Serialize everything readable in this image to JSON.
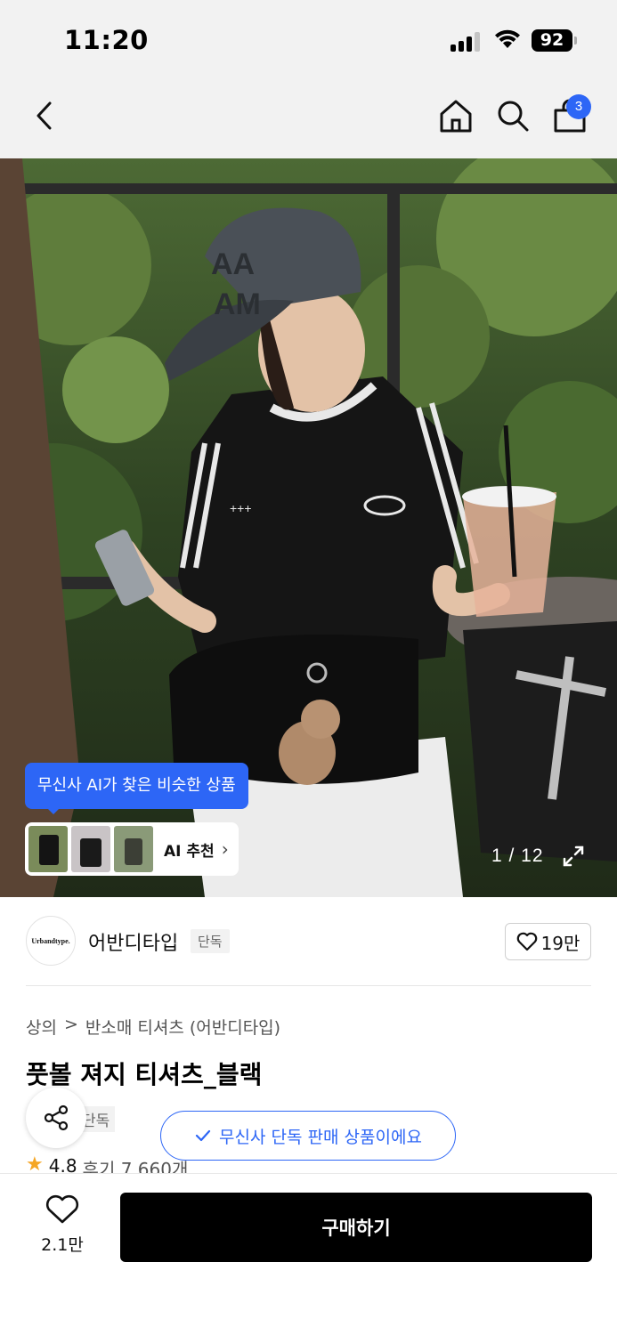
{
  "status": {
    "time": "11:20",
    "battery": "92"
  },
  "nav": {
    "cart_count": "3",
    "icons": [
      "back-icon",
      "home-icon",
      "search-icon",
      "cart-icon"
    ]
  },
  "gallery": {
    "ai_tooltip": "무신사 AI가 찾은 비슷한 상품",
    "ai_label": "AI 추천",
    "counter": "1 / 12"
  },
  "brand": {
    "logo_text": "Urbandtype.",
    "name": "어반디타입",
    "exclusive_tag": "단독",
    "like_count": "19만"
  },
  "product": {
    "breadcrumb": [
      "상의",
      "반소매 티셔츠 (어반디타입)"
    ],
    "title": "풋볼 져지 티셔츠_블랙",
    "exclusive_tag_partial": "단독",
    "exclusive_notice": "무신사 단독 판매 상품이에요",
    "rating": "4.8",
    "review_text": "후기 7,660개"
  },
  "bottom": {
    "wish_count": "2.1만",
    "buy_label": "구매하기"
  },
  "colors": {
    "accent": "#2d66f6",
    "buy_button": "#000000",
    "star": "#f5a623"
  }
}
